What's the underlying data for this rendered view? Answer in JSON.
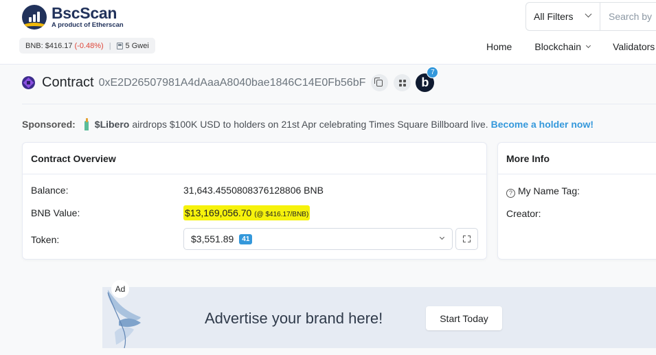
{
  "brand": {
    "name": "BscScan",
    "tagline": "A product of Etherscan"
  },
  "ticker": {
    "price_label": "BNB: $416.17",
    "change": "(-0.48%)",
    "separator": "|",
    "gas": "5 Gwei"
  },
  "search": {
    "filter_label": "All Filters",
    "placeholder": "Search by"
  },
  "nav": {
    "home": "Home",
    "blockchain": "Blockchain",
    "validators": "Validators"
  },
  "contract": {
    "label": "Contract",
    "address": "0xE2D26507981A4dAaaA8040bae1846C14E0Fb56bF",
    "blockscan_letter": "b",
    "blockscan_count": "7"
  },
  "sponsored": {
    "label": "Sponsored:",
    "brand": "$Libero",
    "message": "airdrops $100K USD to holders on 21st Apr celebrating Times Square Billboard live.",
    "link": "Become a holder now!"
  },
  "overview": {
    "title": "Contract Overview",
    "balance_label": "Balance:",
    "balance_value": "31,643.4550808376128806 BNB",
    "bnb_value_label": "BNB Value:",
    "bnb_value": "$13,169,056.70",
    "bnb_rate": "(@ $416.17/BNB)",
    "token_label": "Token:",
    "token_value": "$3,551.89",
    "token_count": "41"
  },
  "more_info": {
    "title": "More Info",
    "name_tag_label": "My Name Tag:",
    "creator_label": "Creator:"
  },
  "ad": {
    "label": "Ad",
    "headline": "Advertise your brand here!",
    "cta": "Start Today"
  },
  "colors": {
    "brand_navy": "#21325b",
    "brand_gold": "#f0b90b",
    "link_blue": "#3498db",
    "negative_red": "#de4437",
    "highlight_yellow": "#f6f20c"
  }
}
